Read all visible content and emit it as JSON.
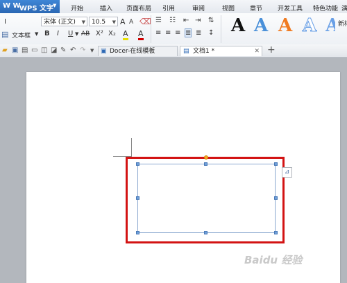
{
  "app": {
    "logo": "W W",
    "title": "WPS 文字"
  },
  "menu": [
    "开始",
    "插入",
    "页面布局",
    "引用",
    "审阅",
    "视图",
    "章节",
    "开发工具",
    "特色功能",
    "演"
  ],
  "ribbon": {
    "paste_partial": "I",
    "textbox_label": "文本框",
    "font_name": "宋体 (正文)",
    "font_size": "10.5",
    "grow_font": "A",
    "shrink_font": "A",
    "bold": "B",
    "italic": "I",
    "underline": "U",
    "strikethrough": "AB",
    "superscript": "X²",
    "subscript": "X₂",
    "highlight": "A",
    "font_color": "A",
    "style_preview": "A",
    "style_colors": [
      "#111111",
      "#4a90d9",
      "#f07b21",
      "#6aa0e6",
      "#6aa0e6"
    ],
    "side_label": "新样"
  },
  "tabs": [
    {
      "label": "Docer-在线模板",
      "active": false
    },
    {
      "label": "文档1 *",
      "active": true
    }
  ],
  "watermark": "Baidu 经验"
}
